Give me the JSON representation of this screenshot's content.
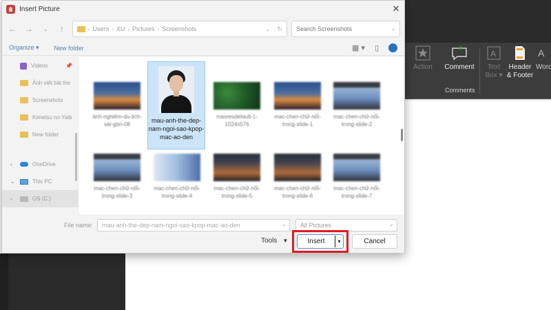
{
  "dialog": {
    "title": "Insert Picture",
    "address": {
      "crumbs": [
        "Users",
        "XU",
        "Pictures",
        "Screenshots"
      ]
    },
    "search_placeholder": "Search Screenshots",
    "commands": {
      "organize": "Organize ▾",
      "new_folder": "New folder"
    },
    "nav": [
      {
        "label": "Videos",
        "icon": "videos-icon",
        "pinned": true
      },
      {
        "label": "Ảnh viết bài the",
        "icon": "folder-icon"
      },
      {
        "label": "Screenshots",
        "icon": "folder-icon"
      },
      {
        "label": "Kimetsu no Yaib",
        "icon": "folder-icon"
      },
      {
        "label": "New folder",
        "icon": "folder-icon"
      },
      {
        "label": "OneDrive",
        "icon": "onedrive-icon"
      },
      {
        "label": "This PC",
        "icon": "this-pc-icon"
      },
      {
        "label": "OS (C:)",
        "icon": "drive-icon"
      }
    ],
    "files": [
      {
        "caption": "ảnh-nghiêm-du-lịch-sài-gòn-08",
        "thumb": "city"
      },
      {
        "caption": "mau-anh-the-dep-nam-ngoi-sao-kpop-mac-ao-den",
        "thumb": "portrait",
        "selected": true
      },
      {
        "caption": "maxresdefault-1-1024x576",
        "thumb": "green"
      },
      {
        "caption": "mac-chen-chữ-nổi-trong-slide-1",
        "thumb": "city"
      },
      {
        "caption": "mac-chen-chữ-nổi-trong-slide-2",
        "thumb": "screen"
      },
      {
        "caption": "mac-chen-chữ-nổi-trong-slide-3",
        "thumb": "screen"
      },
      {
        "caption": "mac-chen-chữ-nổi-trong-slide-4",
        "thumb": "screen2"
      },
      {
        "caption": "mac-chen-chữ-nổi-trong-slide-5",
        "thumb": "dark"
      },
      {
        "caption": "mac-chen-chữ-nổi-trong-slide-6",
        "thumb": "dark"
      },
      {
        "caption": "mac-chen-chữ-nổi-trong-slide-7",
        "thumb": "screen"
      }
    ],
    "footer": {
      "file_name_label": "File name:",
      "file_name_value": "mau-anh-the-dep-nam-ngoi-sao-kpop-mac-ao-den",
      "file_type": "All Pictures",
      "tools": "Tools",
      "insert": "Insert",
      "cancel": "Cancel"
    }
  },
  "ribbon": {
    "action": "Action",
    "comment": "Comment",
    "text_box": "Text Box ▾",
    "header_footer": "Header & Footer",
    "word": "Word",
    "comments_group": "Comments"
  },
  "colors": {
    "highlight": "#e01b24",
    "selection": "#cce4f7"
  }
}
